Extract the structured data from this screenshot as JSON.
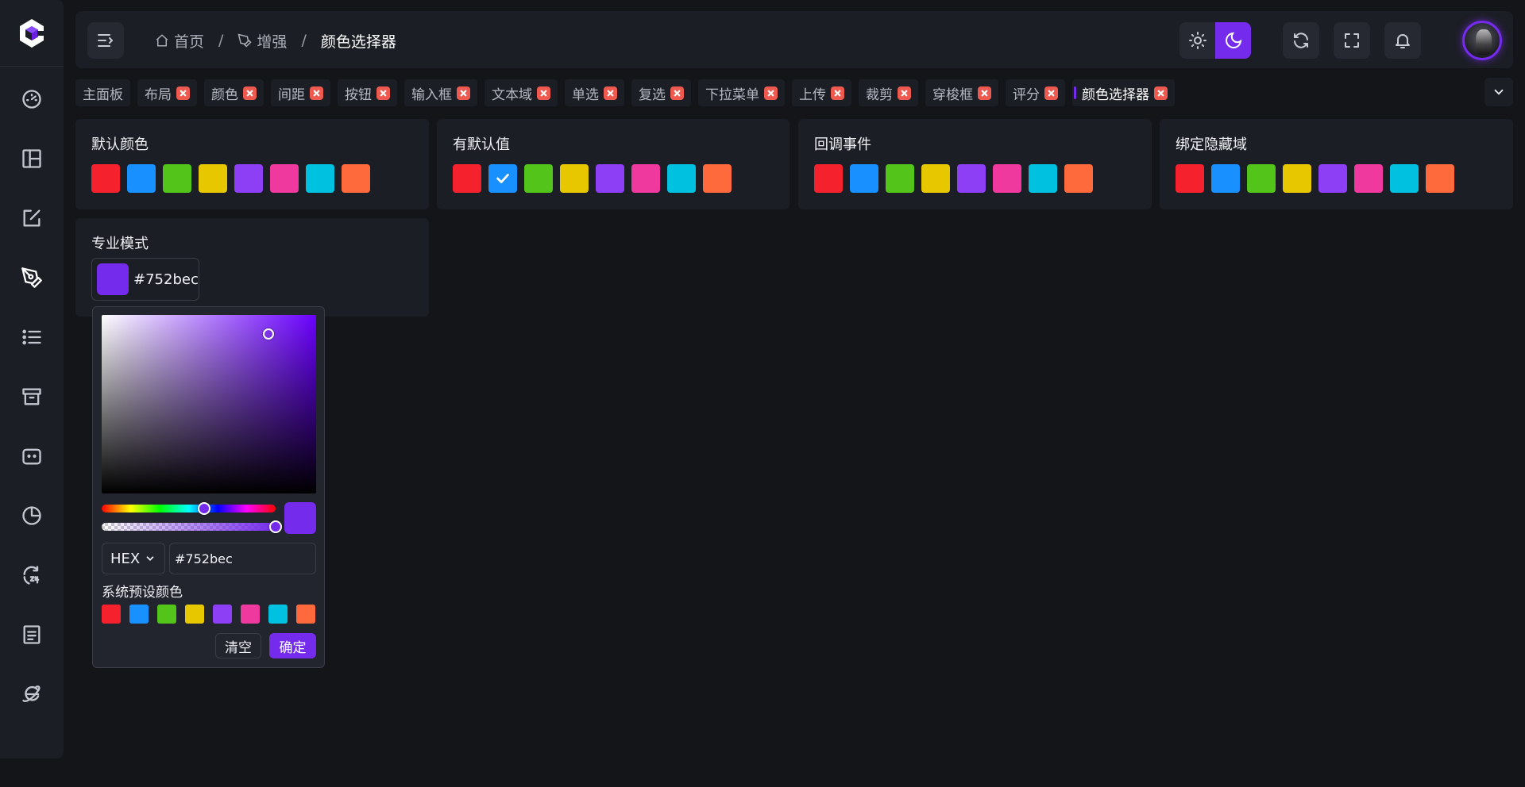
{
  "breadcrumb": {
    "home": "首页",
    "section": "增强",
    "current": "颜色选择器",
    "separator": "/"
  },
  "tabs": [
    {
      "label": "主面板",
      "closable": false
    },
    {
      "label": "布局",
      "closable": true
    },
    {
      "label": "颜色",
      "closable": true
    },
    {
      "label": "间距",
      "closable": true
    },
    {
      "label": "按钮",
      "closable": true
    },
    {
      "label": "输入框",
      "closable": true
    },
    {
      "label": "文本域",
      "closable": true
    },
    {
      "label": "单选",
      "closable": true
    },
    {
      "label": "复选",
      "closable": true
    },
    {
      "label": "下拉菜单",
      "closable": true
    },
    {
      "label": "上传",
      "closable": true
    },
    {
      "label": "裁剪",
      "closable": true
    },
    {
      "label": "穿梭框",
      "closable": true
    },
    {
      "label": "评分",
      "closable": true
    },
    {
      "label": "颜色选择器",
      "closable": true,
      "active": true
    }
  ],
  "palette": [
    "#f5222d",
    "#1890ff",
    "#52c41a",
    "#e6c700",
    "#8c3ff5",
    "#f0399f",
    "#00c2e0",
    "#ff6a3d"
  ],
  "cards": {
    "default": {
      "title": "默认颜色"
    },
    "with_default": {
      "title": "有默认值",
      "selected_index": 1
    },
    "callback": {
      "title": "回调事件"
    },
    "hidden": {
      "title": "绑定隐藏域"
    },
    "pro": {
      "title": "专业模式",
      "value": "#752bec"
    }
  },
  "picker": {
    "color": "#752bec",
    "format": "HEX",
    "hex_value": "#752bec",
    "hue_percent": 0.59,
    "alpha_percent": 1.0,
    "preset_label": "系统预设颜色",
    "clear_label": "清空",
    "confirm_label": "确定"
  },
  "colors": {
    "accent": "#752bec",
    "surface": "#1c1e25",
    "background": "#141519",
    "close": "#ee5a4f"
  },
  "icons": {
    "sidebar": [
      "dashboard-icon",
      "layout-icon",
      "edit-icon",
      "pen-tool-icon",
      "list-icon",
      "archive-icon",
      "bot-icon",
      "pie-chart-icon",
      "clock-24-icon",
      "document-icon",
      "ie-icon"
    ],
    "header": [
      "menu-fold-icon",
      "home-icon",
      "pen-icon",
      "sun-icon",
      "moon-icon",
      "refresh-icon",
      "fullscreen-icon",
      "bell-icon",
      "chevron-down-icon"
    ]
  }
}
